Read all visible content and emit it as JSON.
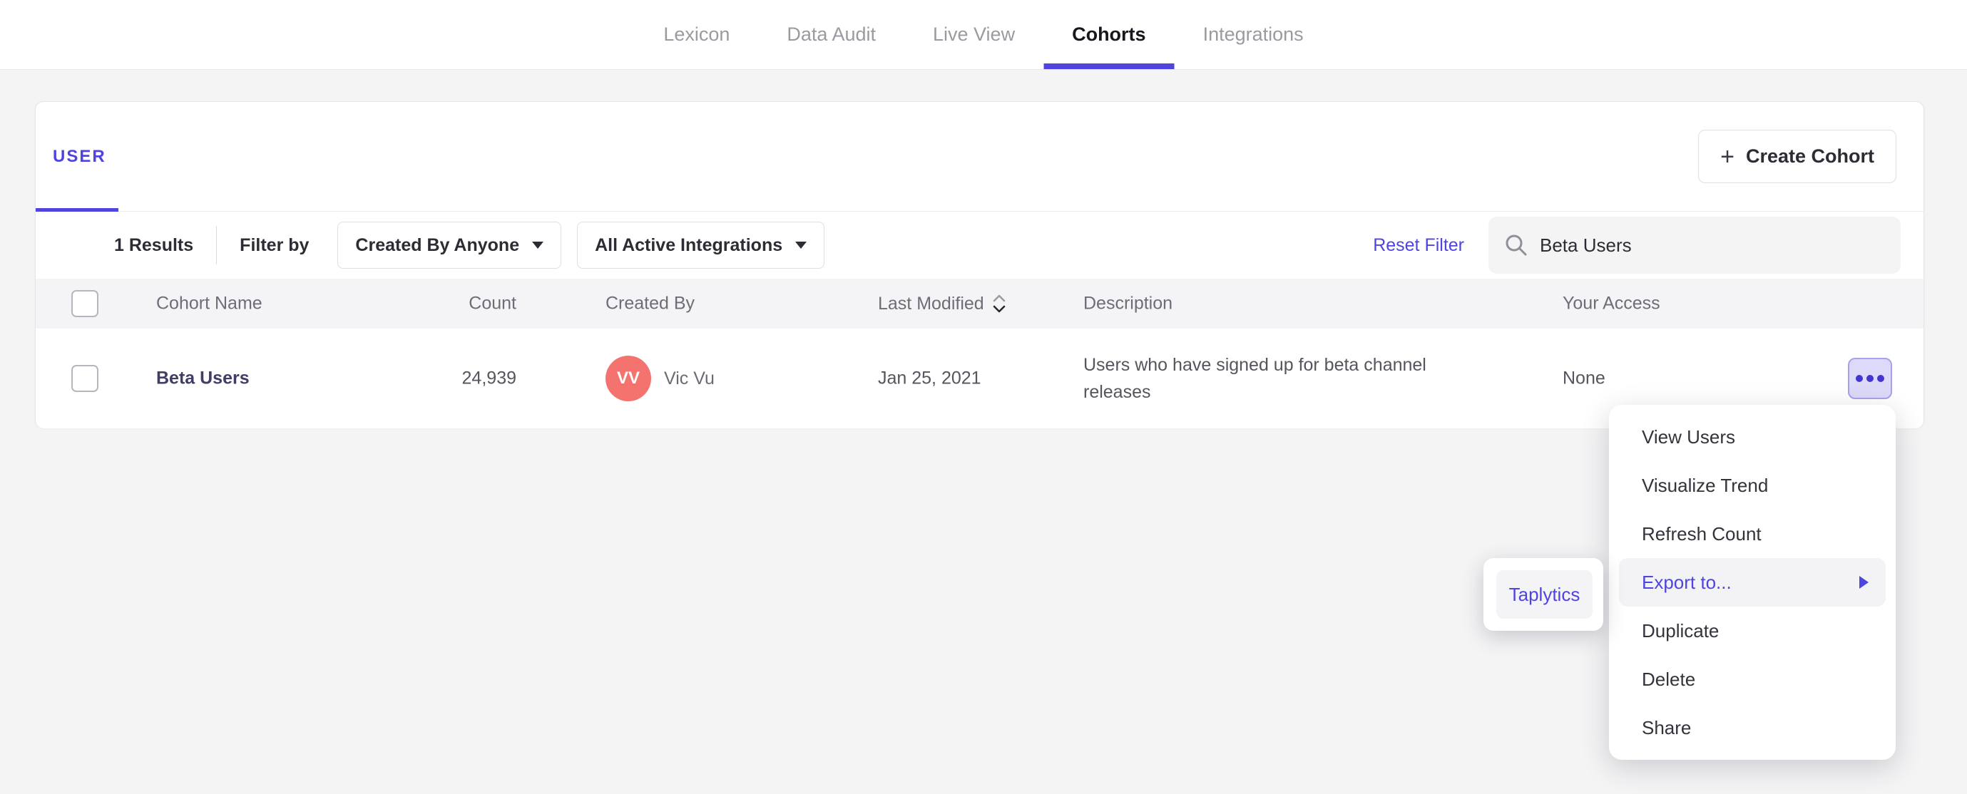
{
  "nav": {
    "tabs": [
      {
        "label": "Lexicon",
        "active": false
      },
      {
        "label": "Data Audit",
        "active": false
      },
      {
        "label": "Live View",
        "active": false
      },
      {
        "label": "Cohorts",
        "active": true
      },
      {
        "label": "Integrations",
        "active": false
      }
    ]
  },
  "card": {
    "type_tab": "USER",
    "create_button": "Create Cohort",
    "filter_bar": {
      "results": "1 Results",
      "filter_by": "Filter by",
      "created_by_dropdown": "Created By Anyone",
      "integrations_dropdown": "All Active Integrations",
      "reset_filter": "Reset Filter",
      "search_value": "Beta Users"
    },
    "table": {
      "headers": {
        "name": "Cohort Name",
        "count": "Count",
        "created_by": "Created By",
        "last_modified": "Last Modified",
        "description": "Description",
        "access": "Your Access"
      },
      "rows": [
        {
          "name": "Beta Users",
          "count": "24,939",
          "avatar_initials": "VV",
          "created_by": "Vic Vu",
          "last_modified": "Jan 25, 2021",
          "description": "Users who have signed up for beta channel releases",
          "access": "None"
        }
      ]
    }
  },
  "context_menu": {
    "items": [
      {
        "label": "View Users"
      },
      {
        "label": "Visualize Trend"
      },
      {
        "label": "Refresh Count"
      },
      {
        "label": "Export to...",
        "highlighted": true,
        "has_submenu": true
      },
      {
        "label": "Duplicate"
      },
      {
        "label": "Delete"
      },
      {
        "label": "Share"
      }
    ],
    "submenu": {
      "items": [
        {
          "label": "Taplytics",
          "highlighted": true
        }
      ]
    }
  },
  "colors": {
    "accent": "#4f44e0",
    "avatar": "#f4736f",
    "cohort_link": "#403d66",
    "actions_button_bg": "#dcdaf8",
    "page_background": "#f4f4f5"
  }
}
